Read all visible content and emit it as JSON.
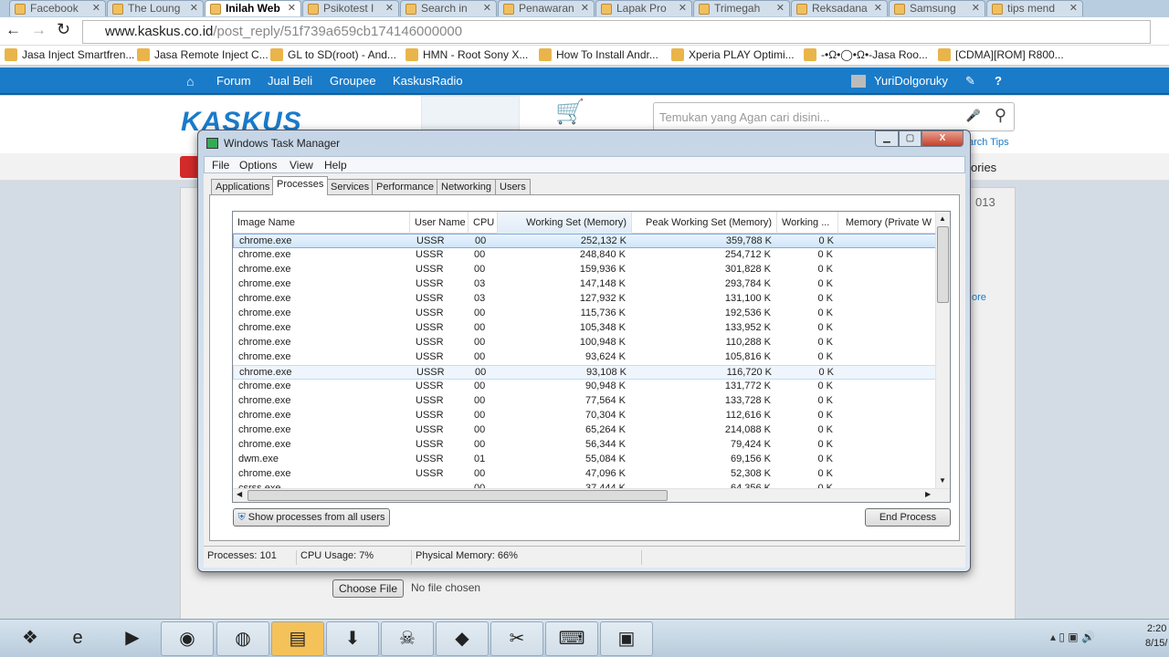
{
  "browser": {
    "tabs": [
      {
        "label": "Facebook"
      },
      {
        "label": "The Loung"
      },
      {
        "label": "Inilah Web",
        "active": true
      },
      {
        "label": "Psikotest I"
      },
      {
        "label": "Search in"
      },
      {
        "label": "Penawaran"
      },
      {
        "label": "Lapak Pro"
      },
      {
        "label": "Trimegah"
      },
      {
        "label": "Reksadana"
      },
      {
        "label": "Samsung"
      },
      {
        "label": "tips mend"
      }
    ],
    "url_host": "www.kaskus.co.id",
    "url_path": "/post_reply/51f739a659cb174146000000",
    "bookmarks": [
      "Jasa Inject Smartfren...",
      "Jasa Remote Inject C...",
      "GL to SD(root) - And...",
      "HMN - Root Sony X...",
      "How To Install Andr...",
      "Xperia PLAY Optimi...",
      "-•Ω•◯•Ω•-Jasa Roo...",
      "[CDMA][ROM] R800..."
    ]
  },
  "kaskus": {
    "nav": [
      "Forum",
      "Jual Beli",
      "Groupee",
      "KaskusRadio"
    ],
    "username": "YuriDolgoruky",
    "logo": "KASKUS",
    "search_placeholder": "Temukan yang Agan cari disini...",
    "search_tips": "arch Tips",
    "categories": "ories",
    "date_fragment": "013",
    "more": "ore",
    "choose_file": "Choose File",
    "no_file": "No file chosen",
    "brand_color": "#1a7bc9"
  },
  "task_manager": {
    "title": "Windows Task Manager",
    "menu": [
      "File",
      "Options",
      "View",
      "Help"
    ],
    "tabs": [
      "Applications",
      "Processes",
      "Services",
      "Performance",
      "Networking",
      "Users"
    ],
    "active_tab": "Processes",
    "columns": [
      "Image Name",
      "User Name",
      "CPU",
      "Working Set (Memory)",
      "Peak Working Set (Memory)",
      "Working ...",
      "Memory (Private W"
    ],
    "sorted_column": "Working Set (Memory)",
    "rows": [
      [
        "chrome.exe",
        "USSR",
        "00",
        "252,132 K",
        "359,788 K",
        "0 K"
      ],
      [
        "chrome.exe",
        "USSR",
        "00",
        "248,840 K",
        "254,712 K",
        "0 K"
      ],
      [
        "chrome.exe",
        "USSR",
        "00",
        "159,936 K",
        "301,828 K",
        "0 K"
      ],
      [
        "chrome.exe",
        "USSR",
        "03",
        "147,148 K",
        "293,784 K",
        "0 K"
      ],
      [
        "chrome.exe",
        "USSR",
        "03",
        "127,932 K",
        "131,100 K",
        "0 K"
      ],
      [
        "chrome.exe",
        "USSR",
        "00",
        "115,736 K",
        "192,536 K",
        "0 K"
      ],
      [
        "chrome.exe",
        "USSR",
        "00",
        "105,348 K",
        "133,952 K",
        "0 K"
      ],
      [
        "chrome.exe",
        "USSR",
        "00",
        "100,948 K",
        "110,288 K",
        "0 K"
      ],
      [
        "chrome.exe",
        "USSR",
        "00",
        "93,624 K",
        "105,816 K",
        "0 K"
      ],
      [
        "chrome.exe",
        "USSR",
        "00",
        "93,108 K",
        "116,720 K",
        "0 K"
      ],
      [
        "chrome.exe",
        "USSR",
        "00",
        "90,948 K",
        "131,772 K",
        "0 K"
      ],
      [
        "chrome.exe",
        "USSR",
        "00",
        "77,564 K",
        "133,728 K",
        "0 K"
      ],
      [
        "chrome.exe",
        "USSR",
        "00",
        "70,304 K",
        "112,616 K",
        "0 K"
      ],
      [
        "chrome.exe",
        "USSR",
        "00",
        "65,264 K",
        "214,088 K",
        "0 K"
      ],
      [
        "chrome.exe",
        "USSR",
        "00",
        "56,344 K",
        "79,424 K",
        "0 K"
      ],
      [
        "dwm.exe",
        "USSR",
        "01",
        "55,084 K",
        "69,156 K",
        "0 K"
      ],
      [
        "chrome.exe",
        "USSR",
        "00",
        "47,096 K",
        "52,308 K",
        "0 K"
      ],
      [
        "csrss.exe",
        "",
        "00",
        "37,444 K",
        "64,356 K",
        "0 K"
      ]
    ],
    "selected_row": 0,
    "show_all_label": "Show processes from all users",
    "end_process_label": "End Process",
    "status": {
      "processes": "Processes: 101",
      "cpu": "CPU Usage: 7%",
      "memory": "Physical Memory: 66%"
    }
  },
  "taskbar": {
    "icons": [
      "start-orb",
      "internet-explorer",
      "media-player",
      "chrome",
      "firefox",
      "windows-explorer",
      "internet-download-manager",
      "skull-app",
      "usb-app",
      "tools-app",
      "network-app",
      "task-manager"
    ],
    "clock_time": "2:20",
    "clock_date": "8/15/"
  }
}
